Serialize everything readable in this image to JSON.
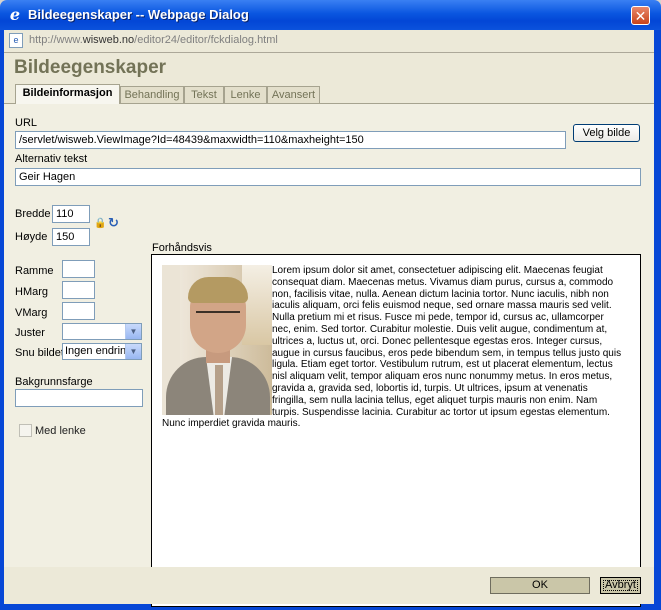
{
  "window": {
    "title": "Bildeegenskaper -- Webpage Dialog",
    "close_glyph": "✕",
    "address_url_prefix": "http://www.",
    "address_url_domain": "wisweb.no",
    "address_url_suffix": "/editor24/editor/fckdialog.html"
  },
  "dialog": {
    "title": "Bildeegenskaper",
    "tabs": [
      {
        "label": "Bildeinformasjon",
        "active": true
      },
      {
        "label": "Behandling",
        "active": false
      },
      {
        "label": "Tekst",
        "active": false
      },
      {
        "label": "Lenke",
        "active": false
      },
      {
        "label": "Avansert",
        "active": false
      }
    ]
  },
  "form": {
    "url_label": "URL",
    "url_value": "/servlet/wisweb.ViewImage?Id=48439&maxwidth=110&maxheight=150",
    "browse_button": "Velg bilde",
    "alt_label": "Alternativ tekst",
    "alt_value": "Geir Hagen",
    "width_label": "Bredde",
    "width_value": "110",
    "height_label": "Høyde",
    "height_value": "150",
    "border_label": "Ramme",
    "border_value": "",
    "hspace_label": "HMarg",
    "hspace_value": "",
    "vspace_label": "VMarg",
    "vspace_value": "",
    "align_label": "Juster",
    "align_value": "",
    "wrap_label": "Snu bildet",
    "wrap_value": "Ingen endring",
    "bgcolor_label": "Bakgrunnsfarge",
    "bgcolor_value": "",
    "link_label": "Med lenke"
  },
  "preview": {
    "label": "Forhåndsvis",
    "text": "Lorem ipsum dolor sit amet, consectetuer adipiscing elit. Maecenas feugiat consequat diam. Maecenas metus. Vivamus diam purus, cursus a, commodo non, facilisis vitae, nulla. Aenean dictum lacinia tortor. Nunc iaculis, nibh non iaculis aliquam, orci felis euismod neque, sed ornare massa mauris sed velit. Nulla pretium mi et risus. Fusce mi pede, tempor id, cursus ac, ullamcorper nec, enim. Sed tortor. Curabitur molestie. Duis velit augue, condimentum at, ultrices a, luctus ut, orci. Donec pellentesque egestas eros. Integer cursus, augue in cursus faucibus, eros pede bibendum sem, in tempus tellus justo quis ligula. Etiam eget tortor. Vestibulum rutrum, est ut placerat elementum, lectus nisl aliquam velit, tempor aliquam eros nunc nonummy metus. In eros metus, gravida a, gravida sed, lobortis id, turpis. Ut ultrices, ipsum at venenatis fringilla, sem nulla lacinia tellus, eget aliquet turpis mauris non enim. Nam turpis. Suspendisse lacinia. Curabitur ac tortor ut ipsum egestas elementum. Nunc imperdiet gravida mauris."
  },
  "footer": {
    "ok_button": "OK",
    "cancel_button": "Avbryt"
  },
  "icons": {
    "app": "ie-icon",
    "lock": "lock-icon",
    "reset": "reset-size-icon"
  }
}
